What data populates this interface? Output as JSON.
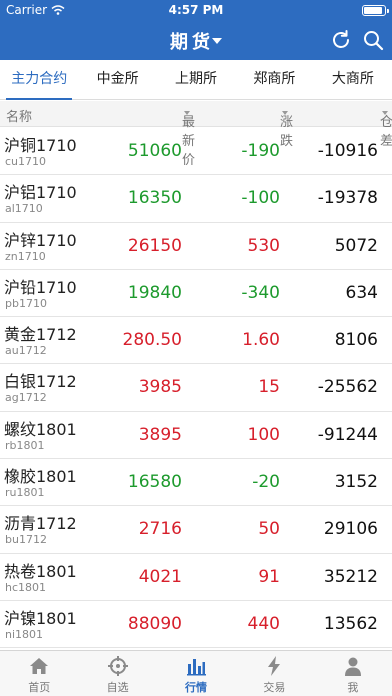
{
  "status_bar": {
    "carrier": "Carrier",
    "time": "4:57 PM",
    "battery_level": 0.9
  },
  "nav": {
    "title": "期货",
    "refresh_icon": "refresh-icon",
    "search_icon": "search-icon"
  },
  "tabs": [
    {
      "label": "主力合约",
      "active": true
    },
    {
      "label": "中金所",
      "active": false
    },
    {
      "label": "上期所",
      "active": false
    },
    {
      "label": "郑商所",
      "active": false
    },
    {
      "label": "大商所",
      "active": false
    }
  ],
  "columns": {
    "name": "名称",
    "price": "最新价",
    "change": "涨跌",
    "open_interest": "仓差"
  },
  "rows": [
    {
      "name": "沪铜1710",
      "code": "cu1710",
      "price": "51060",
      "change": "-190",
      "oi": "-10916",
      "dir": "down"
    },
    {
      "name": "沪铝1710",
      "code": "al1710",
      "price": "16350",
      "change": "-100",
      "oi": "-19378",
      "dir": "down"
    },
    {
      "name": "沪锌1710",
      "code": "zn1710",
      "price": "26150",
      "change": "530",
      "oi": "5072",
      "dir": "up"
    },
    {
      "name": "沪铅1710",
      "code": "pb1710",
      "price": "19840",
      "change": "-340",
      "oi": "634",
      "dir": "down"
    },
    {
      "name": "黄金1712",
      "code": "au1712",
      "price": "280.50",
      "change": "1.60",
      "oi": "8106",
      "dir": "up"
    },
    {
      "name": "白银1712",
      "code": "ag1712",
      "price": "3985",
      "change": "15",
      "oi": "-25562",
      "dir": "up"
    },
    {
      "name": "螺纹1801",
      "code": "rb1801",
      "price": "3895",
      "change": "100",
      "oi": "-91244",
      "dir": "up"
    },
    {
      "name": "橡胶1801",
      "code": "ru1801",
      "price": "16580",
      "change": "-20",
      "oi": "3152",
      "dir": "down"
    },
    {
      "name": "沥青1712",
      "code": "bu1712",
      "price": "2716",
      "change": "50",
      "oi": "29106",
      "dir": "up"
    },
    {
      "name": "热卷1801",
      "code": "hc1801",
      "price": "4021",
      "change": "91",
      "oi": "35212",
      "dir": "up"
    },
    {
      "name": "沪镍1801",
      "code": "ni1801",
      "price": "88090",
      "change": "440",
      "oi": "13562",
      "dir": "up"
    }
  ],
  "tabbar": [
    {
      "label": "首页",
      "icon": "home-icon",
      "active": false
    },
    {
      "label": "自选",
      "icon": "crosshair-icon",
      "active": false
    },
    {
      "label": "行情",
      "icon": "bar-chart-icon",
      "active": true
    },
    {
      "label": "交易",
      "icon": "lightning-icon",
      "active": false
    },
    {
      "label": "我",
      "icon": "person-icon",
      "active": false
    }
  ],
  "colors": {
    "brand": "#2d6cc0",
    "up": "#d71f2b",
    "down": "#1d9a2d"
  }
}
